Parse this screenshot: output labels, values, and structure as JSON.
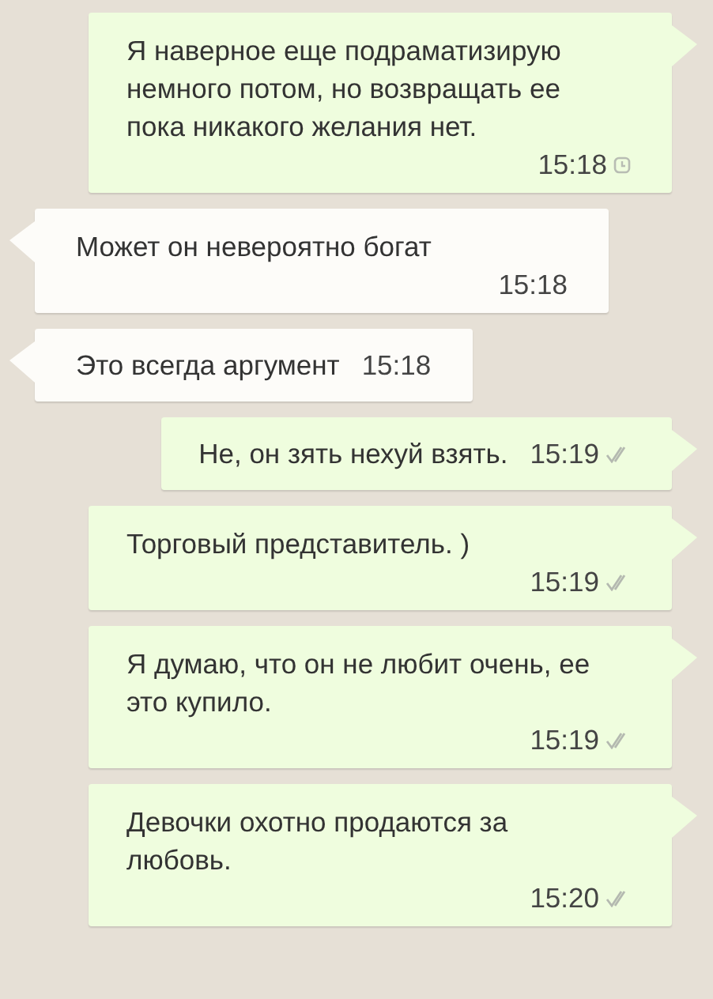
{
  "messages": [
    {
      "kind": "outgoing",
      "text": "Я наверное еще подраматизирую немного потом, но возвращать ее пока никакого желания нет.",
      "time": "15:18",
      "pending": true
    },
    {
      "kind": "incoming",
      "text": "Может он невероятно богат",
      "time": "15:18"
    },
    {
      "kind": "incoming",
      "text": "Это всегда аргумент",
      "time": "15:18"
    },
    {
      "kind": "outgoing",
      "text": "Не, он зять нехуй взять.",
      "time": "15:19",
      "pending": false
    },
    {
      "kind": "outgoing",
      "text": "Торговый представитель. )",
      "time": "15:19",
      "pending": false
    },
    {
      "kind": "outgoing",
      "text": "Я думаю, что он не любит очень, ее это купило.",
      "time": "15:19",
      "pending": false
    },
    {
      "kind": "outgoing",
      "text": "Девочки охотно продаются за любовь.",
      "time": "15:20",
      "pending": false
    }
  ]
}
